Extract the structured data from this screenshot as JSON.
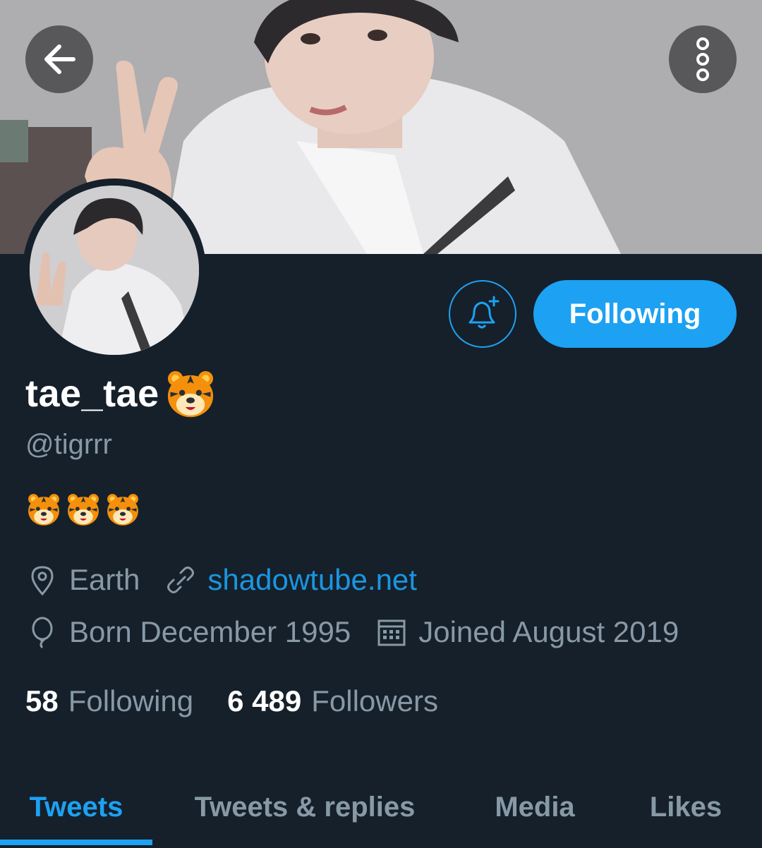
{
  "header": {
    "back_icon": "arrow-left-icon",
    "more_icon": "more-vertical-icon"
  },
  "profile": {
    "display_name": "tae_tae",
    "handle": "@tigrrr",
    "bio_emoji_count": 3,
    "location": "Earth",
    "website": "shadowtube.net",
    "birthday": "Born December 1995",
    "joined": "Joined August 2019"
  },
  "actions": {
    "follow_label": "Following",
    "bell_icon": "bell-plus-icon"
  },
  "stats": {
    "following_count": "58",
    "following_label": "Following",
    "followers_count": "6 489",
    "followers_label": "Followers"
  },
  "tabs": [
    {
      "label": "Tweets",
      "active": true
    },
    {
      "label": "Tweets & replies",
      "active": false
    },
    {
      "label": "Media",
      "active": false
    },
    {
      "label": "Likes",
      "active": false
    }
  ],
  "colors": {
    "background": "#15202b",
    "accent": "#1da1f2",
    "link": "#1b95e0",
    "muted_text": "#8899a6",
    "primary_text": "#ffffff"
  }
}
